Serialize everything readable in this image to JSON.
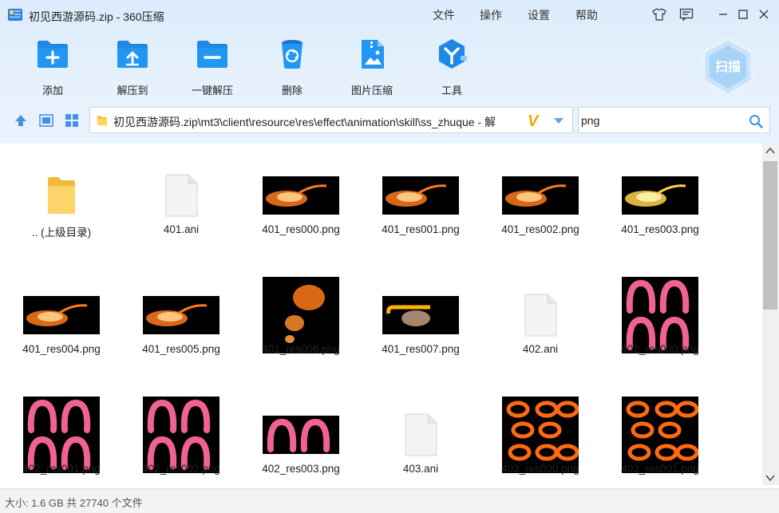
{
  "window": {
    "title": "初见西游源码.zip - 360压缩"
  },
  "menu": [
    "文件",
    "操作",
    "设置",
    "帮助"
  ],
  "toolbar": [
    {
      "label": "添加",
      "icon": "add-icon"
    },
    {
      "label": "解压到",
      "icon": "extract-to-icon"
    },
    {
      "label": "一键解压",
      "icon": "one-click-extract-icon"
    },
    {
      "label": "删除",
      "icon": "delete-icon"
    },
    {
      "label": "图片压缩",
      "icon": "image-compress-icon"
    },
    {
      "label": "工具",
      "icon": "tools-icon"
    }
  ],
  "scan_label": "扫描",
  "address": {
    "path": "初见西游源码.zip\\mt3\\client\\resource\\res\\effect\\animation\\skill\\ss_zhuque - 解"
  },
  "search": {
    "value": "png"
  },
  "files": [
    {
      "name": ".. (上级目录)",
      "kind": "folder"
    },
    {
      "name": "401.ani",
      "kind": "doc"
    },
    {
      "name": "401_res000.png",
      "kind": "fire-small"
    },
    {
      "name": "401_res001.png",
      "kind": "fire-small"
    },
    {
      "name": "401_res002.png",
      "kind": "fire-small"
    },
    {
      "name": "401_res003.png",
      "kind": "fire-yellow"
    },
    {
      "name": "401_res004.png",
      "kind": "fire-small"
    },
    {
      "name": "401_res005.png",
      "kind": "fire-small"
    },
    {
      "name": "401_res006.png",
      "kind": "fire-square"
    },
    {
      "name": "401_res007.png",
      "kind": "fire-hook"
    },
    {
      "name": "402.ani",
      "kind": "doc"
    },
    {
      "name": "402_res000.png",
      "kind": "pink-4"
    },
    {
      "name": "402_res001.png",
      "kind": "pink-4"
    },
    {
      "name": "402_res002.png",
      "kind": "pink-4"
    },
    {
      "name": "402_res003.png",
      "kind": "pink-2"
    },
    {
      "name": "403.ani",
      "kind": "doc"
    },
    {
      "name": "403_res000.png",
      "kind": "orange-grid"
    },
    {
      "name": "403_res001.png",
      "kind": "orange-grid"
    }
  ],
  "status": "大小: 1.6 GB 共 27740 个文件"
}
